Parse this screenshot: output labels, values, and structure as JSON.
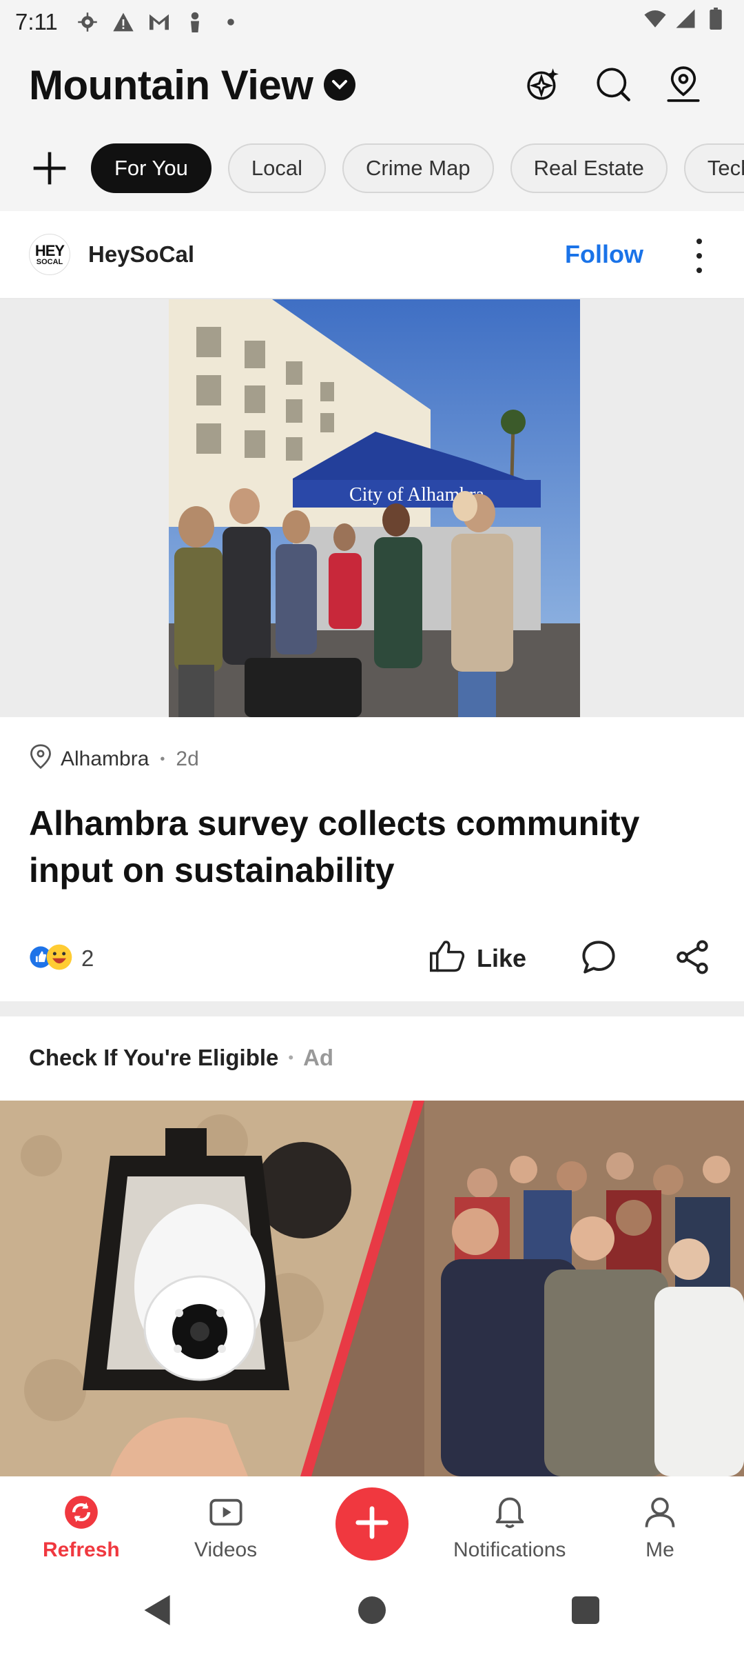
{
  "status_bar": {
    "time": "7:11",
    "left_icons": [
      "settings-icon",
      "warning-icon",
      "gmail-icon",
      "person-icon",
      "dot-icon"
    ],
    "right_icons": [
      "wifi-icon",
      "signal-icon",
      "battery-icon"
    ]
  },
  "header": {
    "location": "Mountain View",
    "actions": [
      "sparkle-icon",
      "search-icon",
      "profile-location-icon"
    ]
  },
  "tabs": [
    {
      "label": "For You",
      "active": true
    },
    {
      "label": "Local",
      "active": false
    },
    {
      "label": "Crime Map",
      "active": false
    },
    {
      "label": "Real Estate",
      "active": false
    },
    {
      "label": "Tech",
      "active": false
    }
  ],
  "post": {
    "publisher": "HeySoCal",
    "avatar_text_top": "HEY",
    "avatar_text_bottom": "SOCAL",
    "follow_label": "Follow",
    "location": "Alhambra",
    "age": "2d",
    "title": "Alhambra survey collects community input on sustainability",
    "reaction_count": "2",
    "like_label": "Like",
    "image_sign_text": "City of Alhambra"
  },
  "ad": {
    "title": "Check If You're Eligible",
    "label": "Ad"
  },
  "bottom_nav": {
    "refresh": "Refresh",
    "videos": "Videos",
    "notifications": "Notifications",
    "me": "Me"
  },
  "colors": {
    "accent": "#f0383f",
    "follow": "#1a73e8",
    "active_tab": "#111111"
  }
}
